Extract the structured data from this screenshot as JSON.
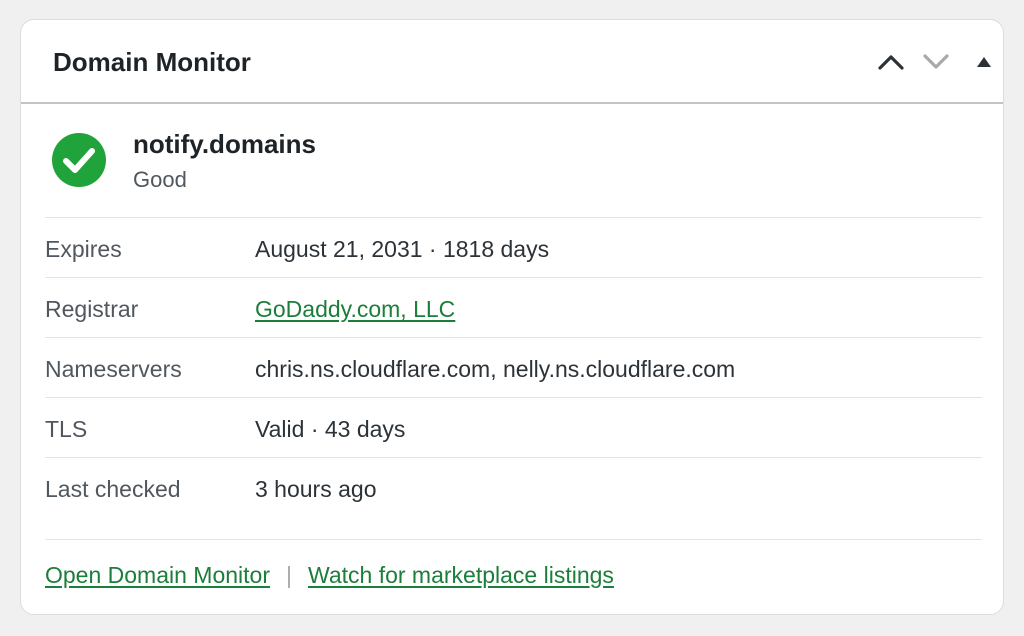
{
  "widget": {
    "title": "Domain Monitor",
    "controls": {
      "move_up_icon": "chevron-up-icon",
      "move_down_icon": "chevron-down-icon",
      "toggle_icon": "triangle-up-icon"
    }
  },
  "status": {
    "icon": "check-circle-icon",
    "color": "#1fa33a",
    "domain": "notify.domains",
    "label": "Good"
  },
  "details": [
    {
      "label": "Expires",
      "value": "August 21, 2031 · 1818 days"
    },
    {
      "label": "Registrar",
      "value": "GoDaddy.com, LLC"
    },
    {
      "label": "Nameservers",
      "value": "chris.ns.cloudflare.com, nelly.ns.cloudflare.com"
    },
    {
      "label": "TLS",
      "value": "Valid · 43 days"
    },
    {
      "label": "Last checked",
      "value": "3 hours ago"
    }
  ],
  "footer": {
    "open_link": "Open Domain Monitor",
    "separator": "|",
    "watch_link": "Watch for marketplace listings"
  },
  "colors": {
    "link": "#1b7e3a",
    "success": "#1fa33a"
  }
}
